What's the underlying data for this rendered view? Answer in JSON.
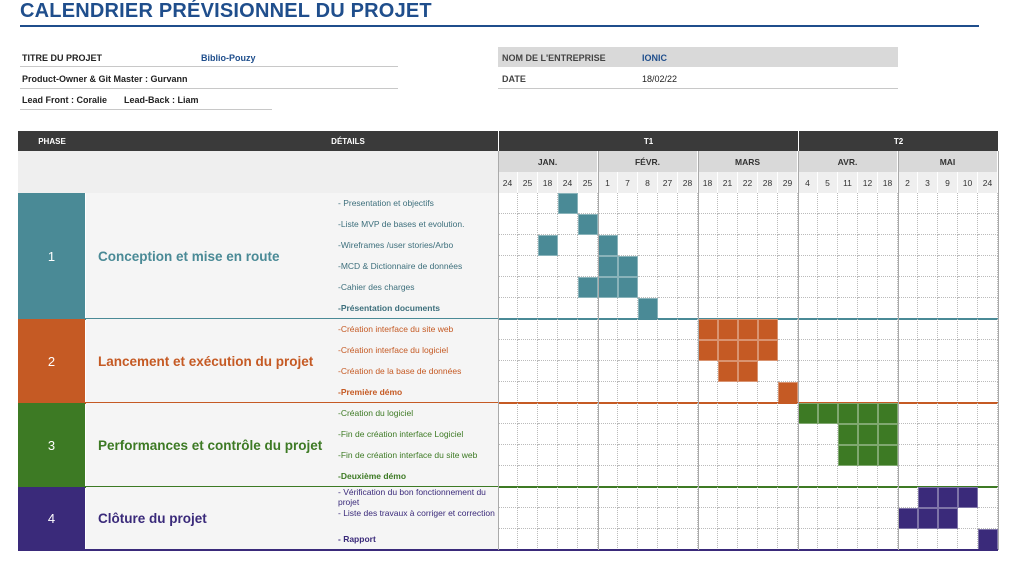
{
  "title": "CALENDRIER PRÉVISIONNEL DU PROJET",
  "info": {
    "project_label": "TITRE DU PROJET",
    "project_value": "Biblio-Pouzy",
    "owner_line": "Product-Owner & Git Master : Gurvann",
    "lead_front": "Lead Front : Coralie",
    "lead_back": "Lead-Back : Liam",
    "company_label": "NOM DE L'ENTREPRISE",
    "company_value": "IONIC",
    "date_label": "DATE",
    "date_value": "18/02/22"
  },
  "header": {
    "phase": "PHASE",
    "details": "DÉTAILS",
    "quarters": [
      "T1",
      "T2"
    ],
    "months": [
      "JAN.",
      "FÉVR.",
      "MARS",
      "AVR.",
      "MAI"
    ],
    "days": [
      "24",
      "25",
      "18",
      "24",
      "25",
      "1",
      "7",
      "8",
      "27",
      "28",
      "18",
      "21",
      "22",
      "28",
      "29",
      "4",
      "5",
      "11",
      "12",
      "18",
      "2",
      "3",
      "9",
      "10",
      "24"
    ]
  },
  "phases": [
    {
      "number": "1",
      "title": "Conception et mise en route",
      "color": "#4a8a96",
      "tasks": [
        {
          "label": "- Presentation et objectifs",
          "bold": false,
          "cells": [
            3
          ]
        },
        {
          "label": "-Liste MVP de bases et evolution.",
          "bold": false,
          "cells": [
            4
          ]
        },
        {
          "label": "-Wireframes /user stories/Arbo",
          "bold": false,
          "cells": [
            2,
            5
          ]
        },
        {
          "label": "-MCD & Dictionnaire de données",
          "bold": false,
          "cells": [
            5,
            6
          ]
        },
        {
          "label": "-Cahier des charges",
          "bold": false,
          "cells": [
            4,
            5,
            6
          ]
        },
        {
          "label": "-Présentation documents",
          "bold": true,
          "cells": [
            7
          ]
        }
      ]
    },
    {
      "number": "2",
      "title": "Lancement et exécution du projet",
      "color": "#c55a24",
      "tasks": [
        {
          "label": "-Création interface du site web",
          "bold": false,
          "cells": [
            10,
            11,
            12,
            13
          ]
        },
        {
          "label": "-Création interface du logiciel",
          "bold": false,
          "cells": [
            10,
            11,
            12,
            13
          ]
        },
        {
          "label": "-Création de la base de données",
          "bold": false,
          "cells": [
            11,
            12
          ]
        },
        {
          "label": "-Première démo",
          "bold": true,
          "cells": [
            14
          ]
        }
      ]
    },
    {
      "number": "3",
      "title": "Performances et contrôle du projet",
      "color": "#3d7a24",
      "tasks": [
        {
          "label": "-Création du logiciel",
          "bold": false,
          "cells": [
            15,
            16,
            17,
            18,
            19
          ]
        },
        {
          "label": "-Fin de création interface Logiciel",
          "bold": false,
          "cells": [
            17,
            18,
            19
          ]
        },
        {
          "label": "-Fin de création interface du site web",
          "bold": false,
          "cells": [
            17,
            18,
            19
          ]
        },
        {
          "label": "-Deuxième démo",
          "bold": true,
          "cells": []
        }
      ]
    },
    {
      "number": "4",
      "title": "Clôture du projet",
      "color": "#3a2a7a",
      "tasks": [
        {
          "label": "- Vérification du bon fonctionnement du projet",
          "bold": false,
          "cells": [
            21,
            22,
            23
          ]
        },
        {
          "label": "- Liste des travaux à corriger et correction",
          "bold": false,
          "cells": [
            20,
            21,
            22
          ]
        },
        {
          "label": "- Rapport",
          "bold": true,
          "cells": [
            24
          ]
        }
      ]
    }
  ]
}
